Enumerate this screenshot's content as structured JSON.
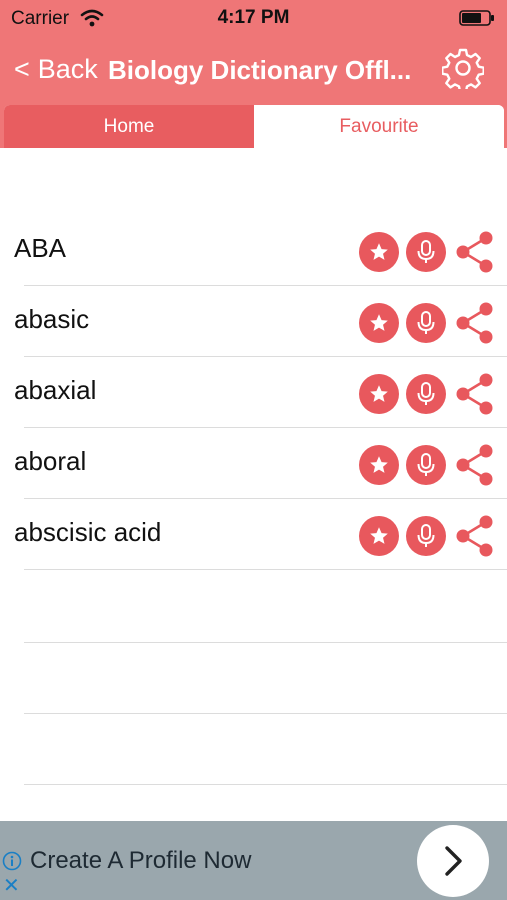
{
  "status_bar": {
    "carrier": "Carrier",
    "time": "4:17 PM"
  },
  "nav": {
    "back_label": "Back",
    "back_chevron": "<",
    "title": "Biology Dictionary Offl...",
    "settings_icon": "gear-icon"
  },
  "tabs": [
    {
      "label": "Home",
      "selected": true
    },
    {
      "label": "Favourite",
      "selected": false
    }
  ],
  "words": [
    {
      "term": "ABA"
    },
    {
      "term": "abasic"
    },
    {
      "term": "abaxial"
    },
    {
      "term": "aboral"
    },
    {
      "term": "abscisic acid"
    }
  ],
  "row_icons": [
    "star-icon",
    "microphone-icon",
    "share-icon"
  ],
  "ad": {
    "text": "Create A Profile Now",
    "close_glyph": "✕"
  },
  "colors": {
    "accent": "#ef7677",
    "button": "#e8585d",
    "ad_background": "#9aa7ad"
  }
}
